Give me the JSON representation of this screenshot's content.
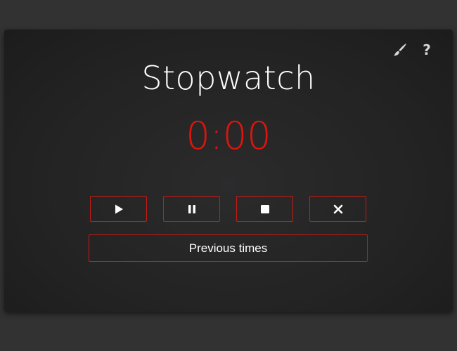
{
  "header": {
    "icons": [
      "paintbrush-icon",
      "help-icon"
    ],
    "help_glyph": "?"
  },
  "title": "Stopwatch",
  "timer": {
    "display": "0:00",
    "color": "#e0140c"
  },
  "controls": {
    "buttons": [
      {
        "name": "play-button",
        "icon": "play-icon"
      },
      {
        "name": "pause-button",
        "icon": "pause-icon"
      },
      {
        "name": "stop-button",
        "icon": "stop-icon"
      },
      {
        "name": "reset-button",
        "icon": "close-icon"
      }
    ],
    "border_color": "#c81a14"
  },
  "previous_times_label": "Previous times",
  "colors": {
    "background": "#323232",
    "card": "#242424",
    "accent": "#e0140c"
  }
}
